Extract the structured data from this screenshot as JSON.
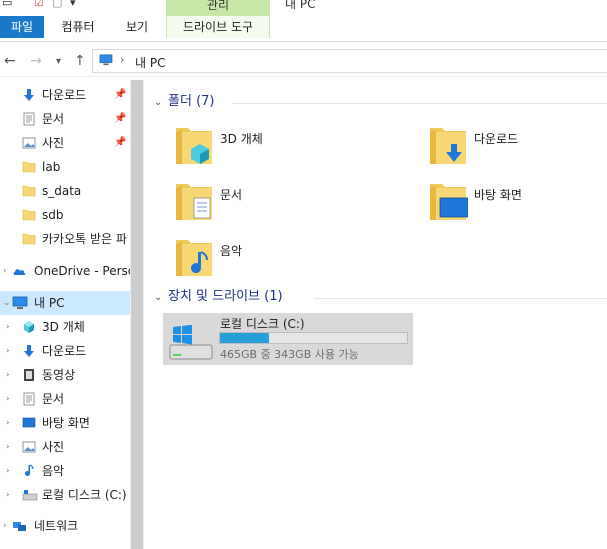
{
  "window": {
    "title": "내 PC"
  },
  "ribbon": {
    "contextual_group": "관리",
    "tabs": [
      {
        "label": "파일"
      },
      {
        "label": "컴퓨터"
      },
      {
        "label": "보기"
      },
      {
        "label": "드라이브 도구"
      }
    ]
  },
  "address": {
    "path": "내 PC"
  },
  "sidebar": {
    "items": [
      {
        "label": "다운로드",
        "icon": "download-icon",
        "pinned": true
      },
      {
        "label": "문서",
        "icon": "document-icon",
        "pinned": true
      },
      {
        "label": "사진",
        "icon": "pictures-icon",
        "pinned": true
      },
      {
        "label": "lab",
        "icon": "folder-icon"
      },
      {
        "label": "s_data",
        "icon": "folder-icon"
      },
      {
        "label": "sdb",
        "icon": "folder-icon"
      },
      {
        "label": "카카오톡 받은 파",
        "icon": "folder-icon"
      },
      {
        "label": "OneDrive - Persor",
        "icon": "onedrive-icon"
      },
      {
        "label": "내 PC",
        "icon": "pc-icon",
        "selected": true
      },
      {
        "label": "3D 개체",
        "icon": "3d-objects-icon"
      },
      {
        "label": "다운로드",
        "icon": "download-icon"
      },
      {
        "label": "동영상",
        "icon": "video-icon"
      },
      {
        "label": "문서",
        "icon": "document-icon"
      },
      {
        "label": "바탕 화면",
        "icon": "desktop-icon"
      },
      {
        "label": "사진",
        "icon": "pictures-icon"
      },
      {
        "label": "음악",
        "icon": "music-icon"
      },
      {
        "label": "로컬 디스크 (C:)",
        "icon": "drive-icon"
      },
      {
        "label": "네트워크",
        "icon": "network-icon"
      }
    ]
  },
  "content": {
    "folders_group": {
      "title": "폴더",
      "count": "(7)"
    },
    "folders": [
      {
        "label": "3D 개체",
        "icon": "3d-objects-icon"
      },
      {
        "label": "다운로드",
        "icon": "download-icon"
      },
      {
        "label": "문서",
        "icon": "document-icon"
      },
      {
        "label": "바탕 화면",
        "icon": "desktop-icon"
      },
      {
        "label": "음악",
        "icon": "music-icon"
      }
    ],
    "drives_group": {
      "title": "장치 및 드라이브",
      "count": "(1)"
    },
    "drive": {
      "name": "로컬 디스크 (C:)",
      "usage_text": "465GB 중 343GB 사용 가능",
      "used_fraction": 0.26,
      "bar_color": "#26a0da"
    }
  },
  "colors": {
    "accent": "#1979ca",
    "selection": "#cce8ff",
    "context_tab": "#c7e8a9"
  }
}
